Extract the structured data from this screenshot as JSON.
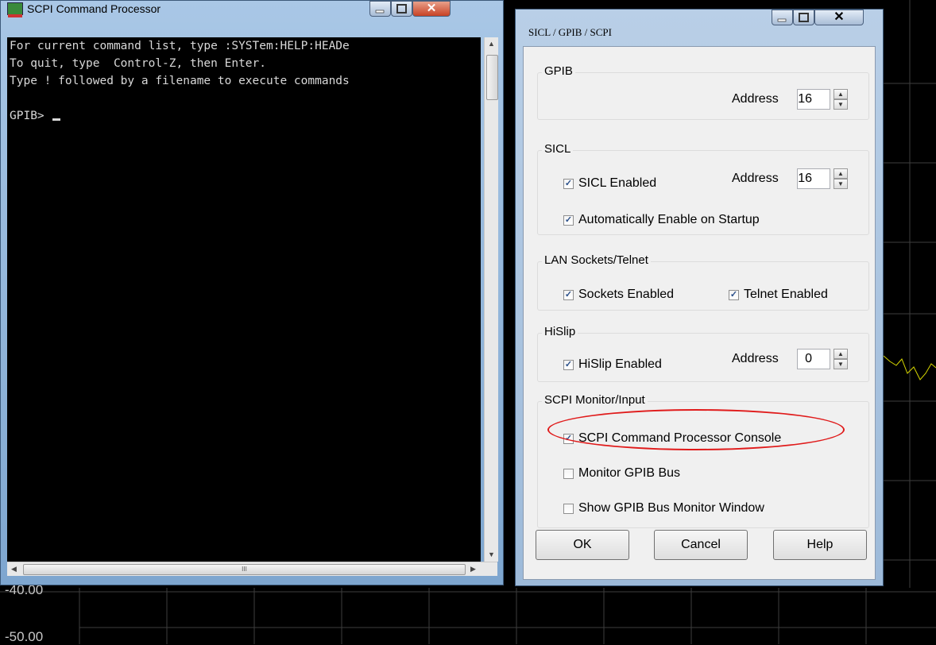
{
  "background": {
    "y_labels": [
      "-40.00",
      "-50.00"
    ]
  },
  "console_window": {
    "title": "SCPI Command Processor",
    "lines": [
      "For current command list, type :SYSTem:HELP:HEADe",
      "To quit, type  Control-Z, then Enter.",
      "Type ! followed by a filename to execute commands",
      "",
      "GPIB> "
    ],
    "hscroll_grip": "III"
  },
  "dialog": {
    "title": "SICL / GPIB / SCPI",
    "gpib": {
      "label": "GPIB",
      "address_label": "Address",
      "address_value": "16"
    },
    "sicl": {
      "label": "SICL",
      "enabled_label": "SICL Enabled",
      "enabled": true,
      "address_label": "Address",
      "address_value": "16",
      "auto_enable_label": "Automatically Enable on Startup",
      "auto_enable": true
    },
    "lan": {
      "label": "LAN Sockets/Telnet",
      "sockets_label": "Sockets Enabled",
      "sockets": true,
      "telnet_label": "Telnet Enabled",
      "telnet": true
    },
    "hislip": {
      "label": "HiSlip",
      "enabled_label": "HiSlip Enabled",
      "enabled": true,
      "address_label": "Address",
      "address_value": "0"
    },
    "scpi_monitor": {
      "label": "SCPI Monitor/Input",
      "console_label": "SCPI Command Processor Console",
      "console": true,
      "monitor_bus_label": "Monitor GPIB Bus",
      "monitor_bus": false,
      "show_monitor_label": "Show GPIB Bus Monitor Window",
      "show_monitor": false
    },
    "buttons": {
      "ok": "OK",
      "cancel": "Cancel",
      "help": "Help"
    }
  },
  "colors": {
    "highlight": "#e01b1b",
    "trace": "#d6d600",
    "grid": "#444444"
  }
}
